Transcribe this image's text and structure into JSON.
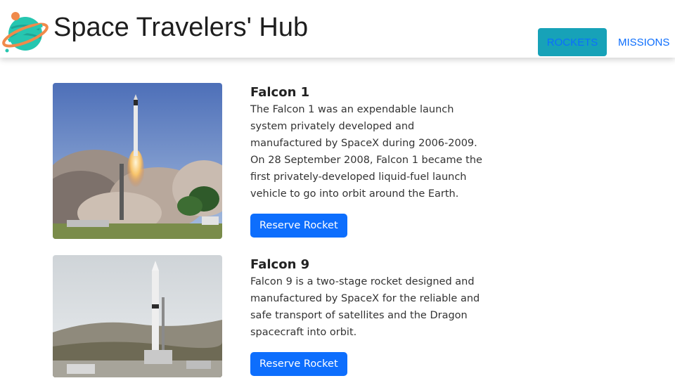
{
  "header": {
    "title": "Space Travelers' Hub",
    "nav": [
      {
        "label": "ROCKETS",
        "active": true
      },
      {
        "label": "MISSIONS",
        "active": false
      }
    ]
  },
  "colors": {
    "accent": "#0d6efd",
    "active_nav_bg": "#17a2b8",
    "planet": "#26c6b0",
    "ring": "#f08a4b"
  },
  "rockets": [
    {
      "name": "Falcon 1",
      "description": "The Falcon 1 was an expendable launch system privately developed and manufactured by SpaceX during 2006-2009. On 28 September 2008, Falcon 1 became the first privately-developed liquid-fuel launch vehicle to go into orbit around the Earth.",
      "button_label": "Reserve Rocket"
    },
    {
      "name": "Falcon 9",
      "description": "Falcon 9 is a two-stage rocket designed and manufactured by SpaceX for the reliable and safe transport of satellites and the Dragon spacecraft into orbit.",
      "button_label": "Reserve Rocket"
    }
  ]
}
